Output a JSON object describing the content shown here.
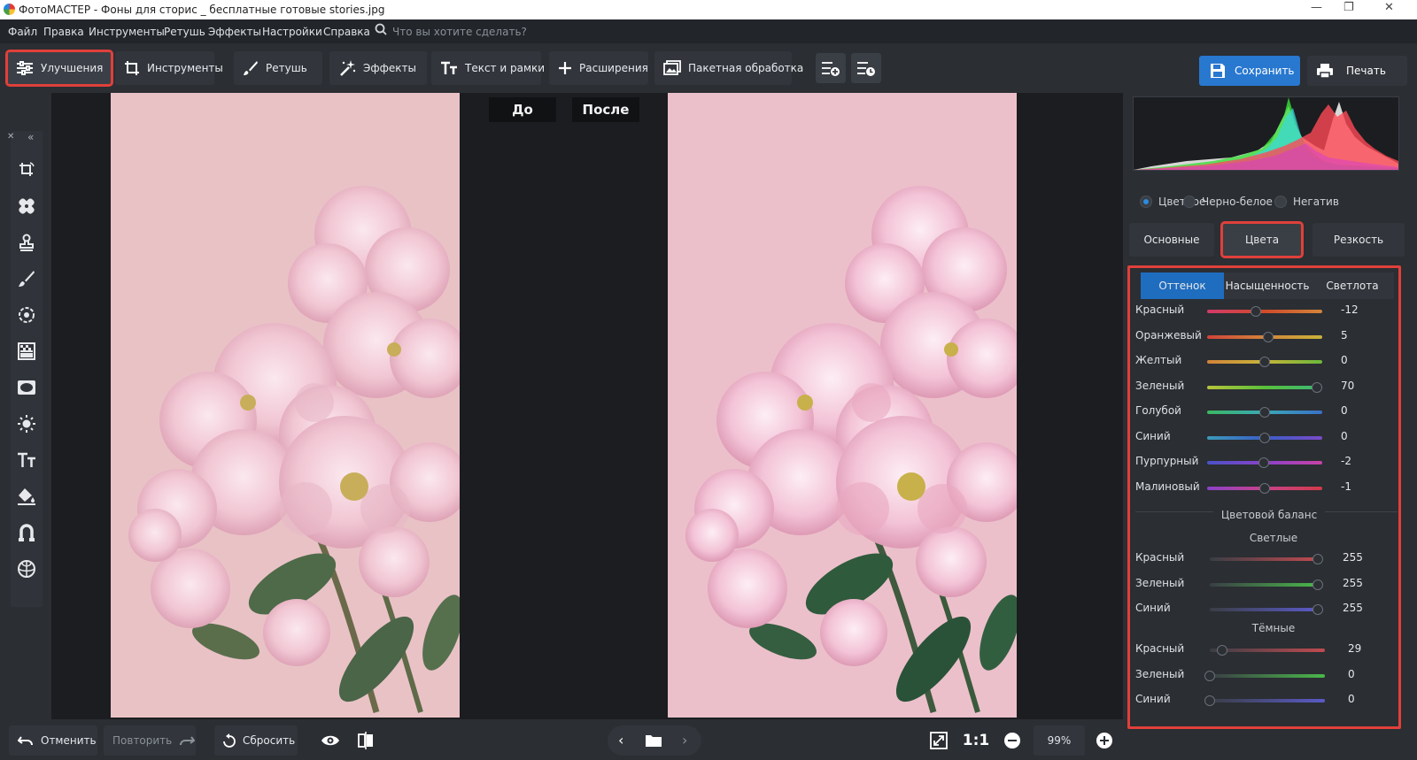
{
  "window": {
    "title": "ФотоМАСТЕР - Фоны для сторис _ бесплатные готовые stories.jpg",
    "controls": [
      "—",
      "❐",
      "✕"
    ]
  },
  "menu": {
    "items": [
      "Файл",
      "Правка",
      "Инструменты",
      "Ретушь",
      "Эффекты",
      "Настройки",
      "Справка"
    ],
    "search_placeholder": "Что вы хотите сделать?"
  },
  "toolbar": {
    "tabs": [
      {
        "label": "Улучшения",
        "icon": "sliders-icon",
        "active": true
      },
      {
        "label": "Инструменты",
        "icon": "crop-icon"
      },
      {
        "label": "Ретушь",
        "icon": "brush-icon"
      },
      {
        "label": "Эффекты",
        "icon": "magic-wand-icon"
      },
      {
        "label": "Текст и рамки",
        "icon": "text-icon"
      },
      {
        "label": "Расширения",
        "icon": "plus-icon"
      },
      {
        "label": "Пакетная обработка",
        "icon": "batch-icon"
      }
    ],
    "save": "Сохранить",
    "print": "Печать"
  },
  "canvas": {
    "before_label": "До",
    "after_label": "После"
  },
  "bottom": {
    "undo": "Отменить",
    "redo": "Повторить",
    "reset": "Сбросить",
    "one_to_one": "1:1",
    "zoom": "99%"
  },
  "panel": {
    "modes": [
      {
        "label": "Цветное",
        "selected": true
      },
      {
        "label": "Черно-белое",
        "selected": false
      },
      {
        "label": "Негатив",
        "selected": false
      }
    ],
    "tabs": [
      {
        "label": "Основные",
        "active": false
      },
      {
        "label": "Цвета",
        "active": true
      },
      {
        "label": "Резкость",
        "active": false
      }
    ],
    "subtabs": [
      {
        "label": "Оттенок",
        "active": true
      },
      {
        "label": "Насыщенность",
        "active": false
      },
      {
        "label": "Светлота",
        "active": false
      }
    ],
    "hue_sliders": [
      {
        "label": "Красный",
        "value": "-12",
        "pos": 0.42,
        "colors": [
          "#d23a6a",
          "#d04a2a",
          "#d2843a"
        ]
      },
      {
        "label": "Оранжевый",
        "value": "5",
        "pos": 0.53,
        "colors": [
          "#d0443a",
          "#d2843a",
          "#c8b43a"
        ]
      },
      {
        "label": "Желтый",
        "value": "0",
        "pos": 0.5,
        "colors": [
          "#d2843a",
          "#c8b43a",
          "#6ab83a"
        ]
      },
      {
        "label": "Зеленый",
        "value": "70",
        "pos": 0.95,
        "colors": [
          "#b8c43a",
          "#5ac03a",
          "#3ab878"
        ]
      },
      {
        "label": "Голубой",
        "value": "0",
        "pos": 0.5,
        "colors": [
          "#3ab860",
          "#3aa8b8",
          "#3a70c8"
        ]
      },
      {
        "label": "Синий",
        "value": "0",
        "pos": 0.5,
        "colors": [
          "#3a9ab8",
          "#3a5ec8",
          "#7a4ac8"
        ]
      },
      {
        "label": "Пурпурный",
        "value": "-2",
        "pos": 0.49,
        "colors": [
          "#4a52c8",
          "#8a42c8",
          "#c842a8"
        ]
      },
      {
        "label": "Малиновый",
        "value": "-1",
        "pos": 0.5,
        "colors": [
          "#8a42c8",
          "#c8428a",
          "#d23a4a"
        ]
      }
    ],
    "balance_title": "Цветовой баланс",
    "light_title": "Светлые",
    "light_sliders": [
      {
        "label": "Красный",
        "value": "255",
        "pos": 1.0,
        "colors": [
          "#3a3e45",
          "#c04a50"
        ]
      },
      {
        "label": "Зеленый",
        "value": "255",
        "pos": 1.0,
        "colors": [
          "#3a3e45",
          "#4ab84a"
        ]
      },
      {
        "label": "Синий",
        "value": "255",
        "pos": 1.0,
        "colors": [
          "#3a3e45",
          "#5a5ac8"
        ]
      }
    ],
    "dark_title": "Тёмные",
    "dark_sliders": [
      {
        "label": "Красный",
        "value": "29",
        "pos": 0.11,
        "colors": [
          "#3a3e45",
          "#c04a50"
        ]
      },
      {
        "label": "Зеленый",
        "value": "0",
        "pos": 0.0,
        "colors": [
          "#3a3e45",
          "#4ab84a"
        ]
      },
      {
        "label": "Синий",
        "value": "0",
        "pos": 0.0,
        "colors": [
          "#3a3e45",
          "#5a5ac8"
        ]
      }
    ]
  },
  "colors": {
    "accent": "#2878d0",
    "highlight": "#e0403a",
    "bg": "#2b2e33"
  }
}
